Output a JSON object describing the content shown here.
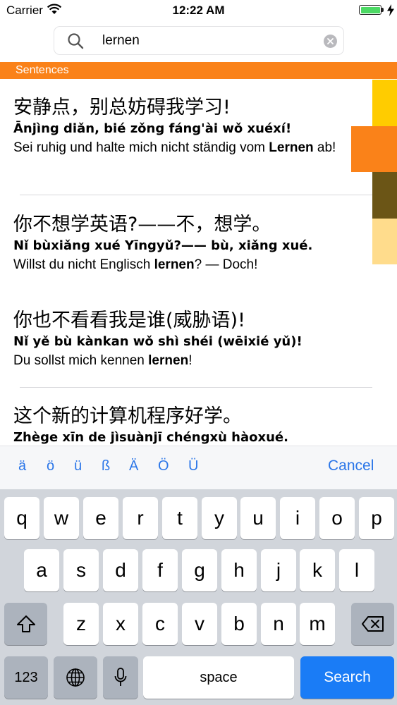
{
  "status_bar": {
    "carrier": "Carrier",
    "time": "12:22 AM"
  },
  "search": {
    "value": "lernen"
  },
  "section": {
    "title": "Sentences"
  },
  "results": [
    {
      "hanzi": "安静点，别总妨碍我学习!",
      "pinyin": "Ānjìng diǎn, bié zǒng fáng'ài wǒ xuéxí!",
      "german_before": "Sei ruhig und halte mich nicht ständig vom ",
      "german_highlight": "Lernen",
      "german_after": " ab!"
    },
    {
      "hanzi": "你不想学英语?——不，想学。",
      "pinyin": "Nǐ bùxiǎng xué  Yīngyǔ?—— bù, xiǎng xué.",
      "german_before": "Willst du nicht Englisch ",
      "german_highlight": "lernen",
      "german_after": "? — Doch!"
    },
    {
      "hanzi": "你也不看看我是谁(威胁语)!",
      "pinyin": "Nǐ yě bù kànkan wǒ shì shéi (wēixié yǔ)!",
      "german_before": "Du sollst mich kennen ",
      "german_highlight": "lernen",
      "german_after": "!"
    },
    {
      "hanzi": "这个新的计算机程序好学。",
      "pinyin": "Zhège xīn de jìsuànjī chéngxù hàoxué.",
      "german_before": "",
      "german_highlight": "",
      "german_after": ""
    }
  ],
  "index_bar": {
    "colors": [
      "#ffcc00",
      "#fa8219",
      "#6b5516",
      "#ffdc8c"
    ]
  },
  "accent_keys": [
    "ä",
    "ö",
    "ü",
    "ß",
    "Ä",
    "Ö",
    "Ü"
  ],
  "cancel_label": "Cancel",
  "keyboard": {
    "row1": [
      "q",
      "w",
      "e",
      "r",
      "t",
      "y",
      "u",
      "i",
      "o",
      "p"
    ],
    "row2": [
      "a",
      "s",
      "d",
      "f",
      "g",
      "h",
      "j",
      "k",
      "l"
    ],
    "row3": [
      "z",
      "x",
      "c",
      "v",
      "b",
      "n",
      "m"
    ],
    "numbers_label": "123",
    "space_label": "space",
    "search_label": "Search"
  }
}
